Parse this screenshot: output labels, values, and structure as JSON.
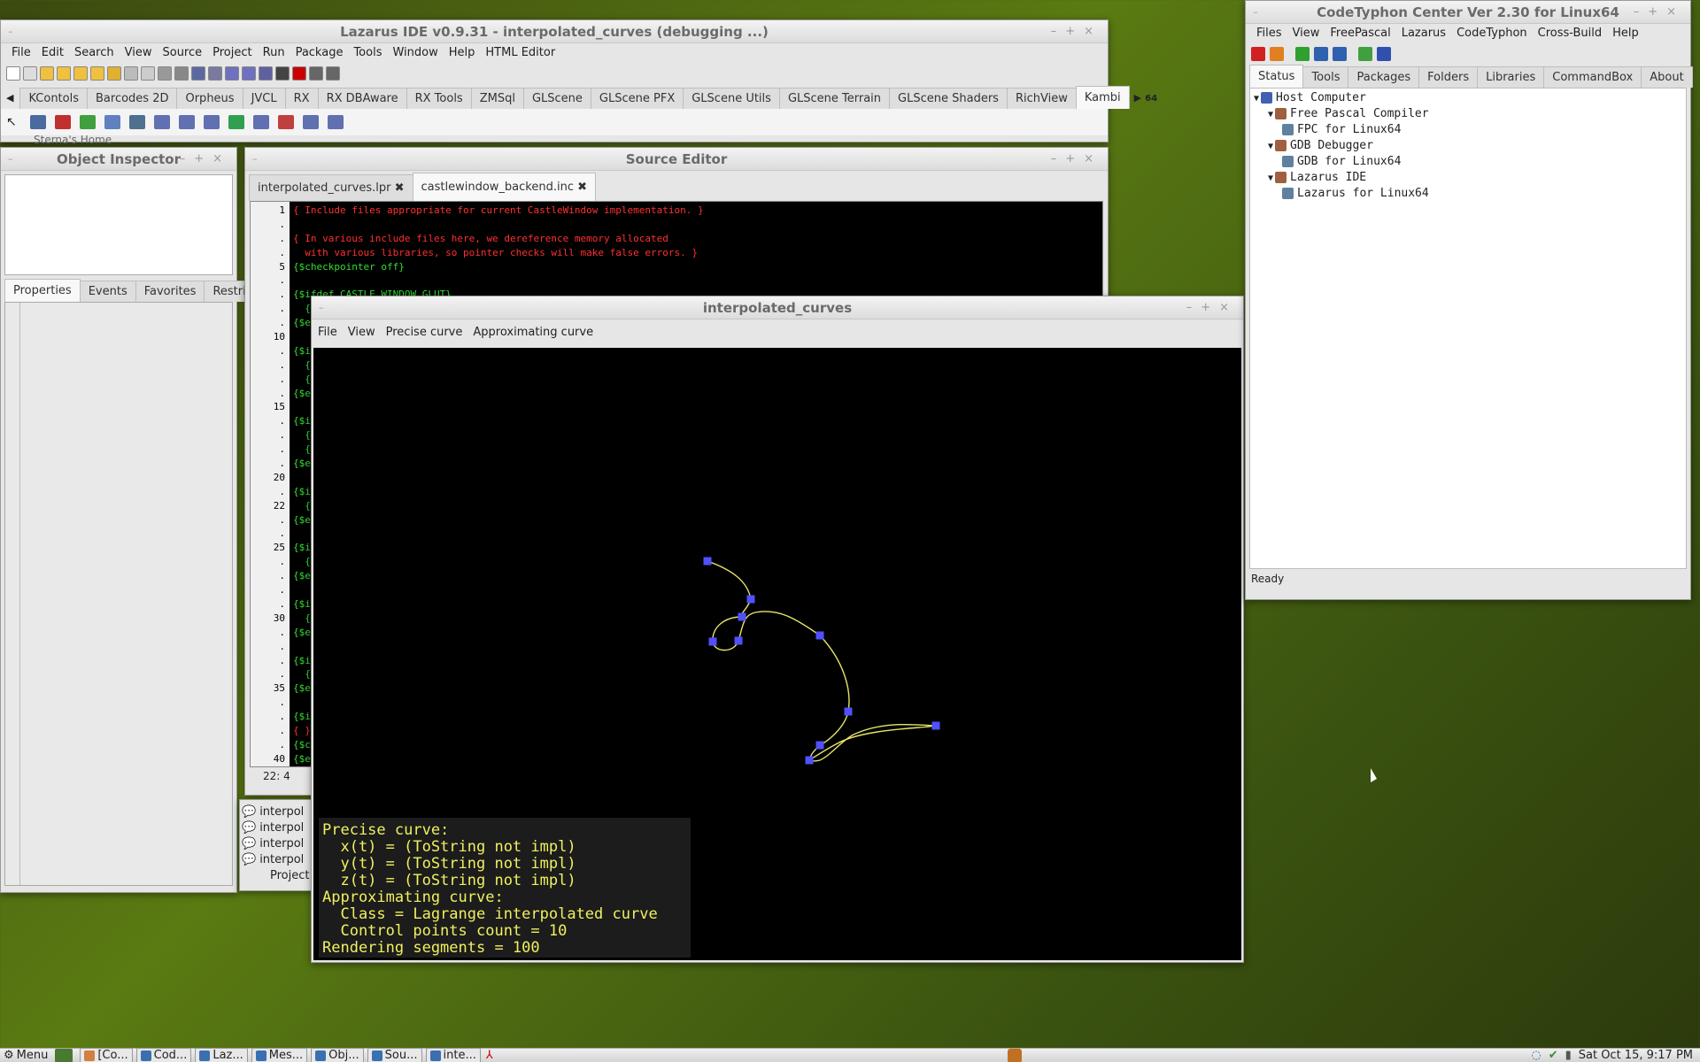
{
  "desktop": {
    "home_label": "Sterna's Home"
  },
  "lazarus": {
    "title": "Lazarus IDE v0.9.31 - interpolated_curves (debugging ...)",
    "menu": [
      "File",
      "Edit",
      "Search",
      "View",
      "Source",
      "Project",
      "Run",
      "Package",
      "Tools",
      "Window",
      "Help",
      "HTML Editor"
    ],
    "palette_tabs": [
      "KContols",
      "Barcodes 2D",
      "Orpheus",
      "JVCL",
      "RX",
      "RX DBAware",
      "RX Tools",
      "ZMSql",
      "GLScene",
      "GLScene PFX",
      "GLScene Utils",
      "GLScene Terrain",
      "GLScene Shaders",
      "RichView",
      "Kambi"
    ],
    "active_palette_tab": "Kambi",
    "badge": "64"
  },
  "object_inspector": {
    "title": "Object Inspector",
    "tabs": [
      "Properties",
      "Events",
      "Favorites",
      "Restricted"
    ]
  },
  "source_editor": {
    "title": "Source Editor",
    "tabs": [
      "interpolated_curves.lpr",
      "castlewindow_backend.inc"
    ],
    "lines": [
      {
        "n": "1",
        "t": "{ Include files appropriate for current CastleWindow implementation. }",
        "c": "red"
      },
      {
        "n": ".",
        "t": "",
        "c": "green"
      },
      {
        "n": ".",
        "t": "{ In various include files here, we dereference memory allocated",
        "c": "red"
      },
      {
        "n": ".",
        "t": "  with various libraries, so pointer checks will make false errors. }",
        "c": "red"
      },
      {
        "n": "5",
        "t": "{$checkpointer off}",
        "c": "green"
      },
      {
        "n": ".",
        "t": "",
        "c": "green"
      },
      {
        "n": ".",
        "t": "{$ifdef CASTLE_WINDOW_GLUT}",
        "c": "green"
      },
      {
        "n": ".",
        "t": "  {",
        "c": "green"
      },
      {
        "n": ".",
        "t": "{$e",
        "c": "green"
      },
      {
        "n": "10",
        "t": "",
        "c": "green"
      },
      {
        "n": ".",
        "t": "{$i",
        "c": "green"
      },
      {
        "n": ".",
        "t": "  {",
        "c": "green"
      },
      {
        "n": ".",
        "t": "  {",
        "c": "green"
      },
      {
        "n": ".",
        "t": "{$e",
        "c": "green"
      },
      {
        "n": "15",
        "t": "",
        "c": "green"
      },
      {
        "n": ".",
        "t": "{$i",
        "c": "green"
      },
      {
        "n": ".",
        "t": "  {",
        "c": "green"
      },
      {
        "n": ".",
        "t": "  {",
        "c": "green"
      },
      {
        "n": ".",
        "t": "{$e",
        "c": "green"
      },
      {
        "n": "20",
        "t": "",
        "c": "green"
      },
      {
        "n": ".",
        "t": "{$i",
        "c": "green"
      },
      {
        "n": "22",
        "t": "  {",
        "c": "green"
      },
      {
        "n": ".",
        "t": "{$e",
        "c": "green"
      },
      {
        "n": ".",
        "t": "",
        "c": "green"
      },
      {
        "n": "25",
        "t": "{$i",
        "c": "green"
      },
      {
        "n": ".",
        "t": "  {",
        "c": "green"
      },
      {
        "n": ".",
        "t": "{$e",
        "c": "green"
      },
      {
        "n": ".",
        "t": "",
        "c": "green"
      },
      {
        "n": ".",
        "t": "{$i",
        "c": "green"
      },
      {
        "n": "30",
        "t": "  {",
        "c": "green"
      },
      {
        "n": ".",
        "t": "{$e",
        "c": "green"
      },
      {
        "n": ".",
        "t": "",
        "c": "green"
      },
      {
        "n": ".",
        "t": "{$i",
        "c": "green"
      },
      {
        "n": ".",
        "t": "  {",
        "c": "green"
      },
      {
        "n": "35",
        "t": "{$e",
        "c": "green"
      },
      {
        "n": ".",
        "t": "",
        "c": "green"
      },
      {
        "n": ".",
        "t": "{$i",
        "c": "green"
      },
      {
        "n": ".",
        "t": "{ }",
        "c": "red"
      },
      {
        "n": ".",
        "t": "{$c",
        "c": "green"
      },
      {
        "n": "40",
        "t": "{$e",
        "c": "green"
      }
    ],
    "status_pos": "22:  4"
  },
  "messages": {
    "items": [
      "interpol",
      "interpol",
      "interpol",
      "interpol"
    ],
    "footer": "Project"
  },
  "curves": {
    "title": "interpolated_curves",
    "menu": [
      "File",
      "View",
      "Precise curve",
      "Approximating curve"
    ],
    "info": [
      "Precise curve:",
      "  x(t) = (ToString not impl)",
      "  y(t) = (ToString not impl)",
      "  z(t) = (ToString not impl)",
      "Approximating curve:",
      "  Class = Lagrange interpolated curve",
      "  Control points count = 10",
      "Rendering segments = 100"
    ],
    "curve_color": "#e5e56a",
    "point_color": "#5050ff"
  },
  "codetyphon": {
    "title": "CodeTyphon Center Ver 2.30 for Linux64",
    "menu": [
      "Files",
      "View",
      "FreePascal",
      "Lazarus",
      "CodeTyphon",
      "Cross-Build",
      "Help"
    ],
    "tabs": [
      "Status",
      "Tools",
      "Packages",
      "Folders",
      "Libraries",
      "CommandBox",
      "About"
    ],
    "tree": [
      {
        "label": "Host Computer",
        "level": 0
      },
      {
        "label": "Free Pascal Compiler",
        "level": 1
      },
      {
        "label": "FPC for Linux64",
        "level": 2
      },
      {
        "label": "GDB Debugger",
        "level": 1
      },
      {
        "label": "GDB for Linux64",
        "level": 2
      },
      {
        "label": "Lazarus IDE",
        "level": 1
      },
      {
        "label": "Lazarus for Linux64",
        "level": 2
      }
    ],
    "status": "Ready"
  },
  "taskbar": {
    "menu": "Menu",
    "items": [
      "[Co...",
      "Cod...",
      "Laz...",
      "Mes...",
      "Obj...",
      "Sou...",
      "inte..."
    ],
    "clock": "Sat Oct 15,  9:17 PM"
  }
}
